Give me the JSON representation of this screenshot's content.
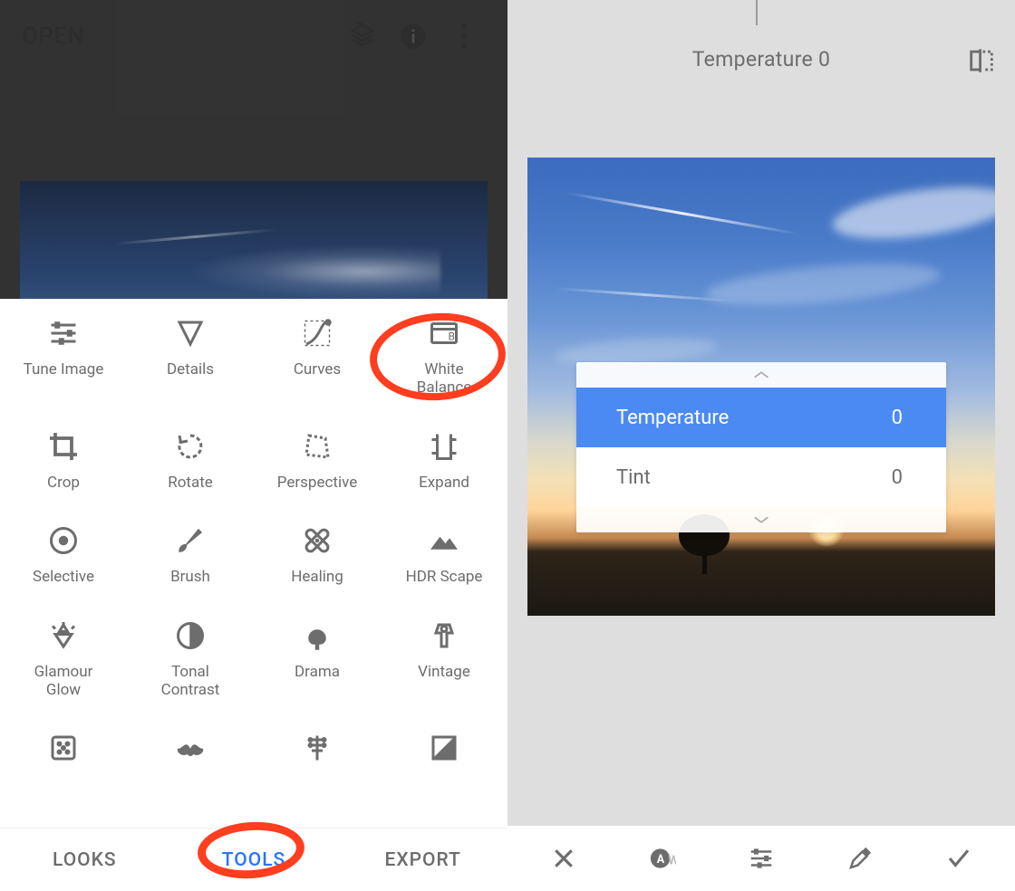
{
  "left": {
    "open_label": "OPEN",
    "tools": [
      {
        "label": "Tune Image"
      },
      {
        "label": "Details"
      },
      {
        "label": "Curves"
      },
      {
        "label": "White\nBalance"
      },
      {
        "label": "Crop"
      },
      {
        "label": "Rotate"
      },
      {
        "label": "Perspective"
      },
      {
        "label": "Expand"
      },
      {
        "label": "Selective"
      },
      {
        "label": "Brush"
      },
      {
        "label": "Healing"
      },
      {
        "label": "HDR Scape"
      },
      {
        "label": "Glamour\nGlow"
      },
      {
        "label": "Tonal\nContrast"
      },
      {
        "label": "Drama"
      },
      {
        "label": "Vintage"
      }
    ],
    "tools_partial": [
      {
        "label": ""
      },
      {
        "label": ""
      },
      {
        "label": ""
      },
      {
        "label": ""
      }
    ],
    "tabs": {
      "looks": "LOOKS",
      "tools": "TOOLS",
      "export": "EXPORT"
    }
  },
  "right": {
    "readout_label": "Temperature",
    "readout_value": "0",
    "params": [
      {
        "name": "Temperature",
        "value": "0",
        "selected": true
      },
      {
        "name": "Tint",
        "value": "0",
        "selected": false
      }
    ]
  }
}
